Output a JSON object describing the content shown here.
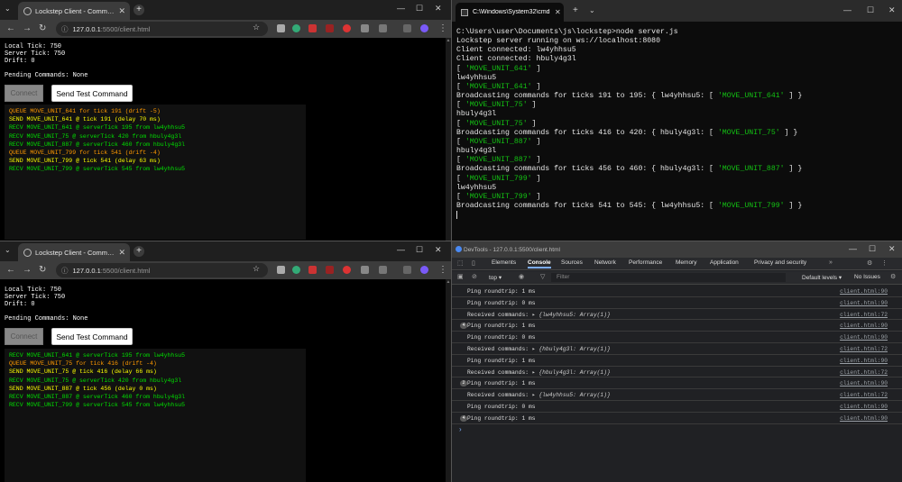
{
  "browser": {
    "tab_title": "Lockstep Client - Command Re",
    "url_host": "127.0.0.1",
    "url_path": ":5500/client.html"
  },
  "clients": [
    {
      "local_tick": "Local Tick: 750",
      "server_tick": "Server Tick: 750",
      "drift": "Drift: 0",
      "pending": "Pending Commands: None",
      "connect_label": "Connect",
      "send_label": "Send Test Command",
      "log": [
        {
          "kind": "queue",
          "text": "QUEUE MOVE_UNIT_641 for tick 191 (drift -5)"
        },
        {
          "kind": "send",
          "text": "SEND MOVE_UNIT_641 @ tick 191 (delay 70 ms)"
        },
        {
          "kind": "recv",
          "text": "RECV MOVE_UNIT_641 @ serverTick 195 from lw4yhhsu5"
        },
        {
          "kind": "recv",
          "text": "RECV MOVE_UNIT_75 @ serverTick 420 from hbuly4g3l"
        },
        {
          "kind": "recv",
          "text": "RECV MOVE_UNIT_887 @ serverTick 460 from hbuly4g3l"
        },
        {
          "kind": "queue",
          "text": "QUEUE MOVE_UNIT_799 for tick 541 (drift -4)"
        },
        {
          "kind": "send",
          "text": "SEND MOVE_UNIT_799 @ tick 541 (delay 63 ms)"
        },
        {
          "kind": "recv",
          "text": "RECV MOVE_UNIT_799 @ serverTick 545 from lw4yhhsu5"
        }
      ]
    },
    {
      "local_tick": "Local Tick: 750",
      "server_tick": "Server Tick: 750",
      "drift": "Drift: 0",
      "pending": "Pending Commands: None",
      "connect_label": "Connect",
      "send_label": "Send Test Command",
      "log": [
        {
          "kind": "recv",
          "text": "RECV MOVE_UNIT_641 @ serverTick 195 from lw4yhhsu5"
        },
        {
          "kind": "queue",
          "text": "QUEUE MOVE_UNIT_75 for tick 416 (drift -4)"
        },
        {
          "kind": "send",
          "text": "SEND MOVE_UNIT_75 @ tick 416 (delay 66 ms)"
        },
        {
          "kind": "recv",
          "text": "RECV MOVE_UNIT_75 @ serverTick 420 from hbuly4g3l"
        },
        {
          "kind": "send",
          "text": "SEND MOVE_UNIT_887 @ tick 456 (delay 0 ms)"
        },
        {
          "kind": "recv",
          "text": "RECV MOVE_UNIT_887 @ serverTick 460 from hbuly4g3l"
        },
        {
          "kind": "recv",
          "text": "RECV MOVE_UNIT_799 @ serverTick 545 from lw4yhhsu5"
        }
      ]
    }
  ],
  "cmd": {
    "tab_title": "C:\\Windows\\System32\\cmd.e",
    "lines": [
      [
        {
          "t": "C:\\Users\\user\\Documents\\js\\lockstep>node server.js"
        }
      ],
      [
        {
          "t": "Lockstep server running on ws://localhost:8080"
        }
      ],
      [
        {
          "t": "Client connected: lw4yhhsu5"
        }
      ],
      [
        {
          "t": "Client connected: hbuly4g3l"
        }
      ],
      [
        {
          "t": "[ "
        },
        {
          "t": "'MOVE_UNIT_641'",
          "g": true
        },
        {
          "t": " ]"
        }
      ],
      [
        {
          "t": "lw4yhhsu5"
        }
      ],
      [
        {
          "t": "[ "
        },
        {
          "t": "'MOVE_UNIT_641'",
          "g": true
        },
        {
          "t": " ]"
        }
      ],
      [
        {
          "t": "Broadcasting commands for ticks 191 to 195: { lw4yhhsu5: [ "
        },
        {
          "t": "'MOVE_UNIT_641'",
          "g": true
        },
        {
          "t": " ] }"
        }
      ],
      [
        {
          "t": "[ "
        },
        {
          "t": "'MOVE_UNIT_75'",
          "g": true
        },
        {
          "t": " ]"
        }
      ],
      [
        {
          "t": "hbuly4g3l"
        }
      ],
      [
        {
          "t": "[ "
        },
        {
          "t": "'MOVE_UNIT_75'",
          "g": true
        },
        {
          "t": " ]"
        }
      ],
      [
        {
          "t": "Broadcasting commands for ticks 416 to 420: { hbuly4g3l: [ "
        },
        {
          "t": "'MOVE_UNIT_75'",
          "g": true
        },
        {
          "t": " ] }"
        }
      ],
      [
        {
          "t": "[ "
        },
        {
          "t": "'MOVE_UNIT_887'",
          "g": true
        },
        {
          "t": " ]"
        }
      ],
      [
        {
          "t": "hbuly4g3l"
        }
      ],
      [
        {
          "t": "[ "
        },
        {
          "t": "'MOVE_UNIT_887'",
          "g": true
        },
        {
          "t": " ]"
        }
      ],
      [
        {
          "t": "Broadcasting commands for ticks 456 to 460: { hbuly4g3l: [ "
        },
        {
          "t": "'MOVE_UNIT_887'",
          "g": true
        },
        {
          "t": " ] }"
        }
      ],
      [
        {
          "t": "[ "
        },
        {
          "t": "'MOVE_UNIT_799'",
          "g": true
        },
        {
          "t": " ]"
        }
      ],
      [
        {
          "t": "lw4yhhsu5"
        }
      ],
      [
        {
          "t": "[ "
        },
        {
          "t": "'MOVE_UNIT_799'",
          "g": true
        },
        {
          "t": " ]"
        }
      ],
      [
        {
          "t": "Broadcasting commands for ticks 541 to 545: { lw4yhhsu5: [ "
        },
        {
          "t": "'MOVE_UNIT_799'",
          "g": true
        },
        {
          "t": " ] }"
        }
      ]
    ]
  },
  "devtools": {
    "title": "DevTools - 127.0.0.1:5500/client.html",
    "tabs": [
      "Elements",
      "Console",
      "Sources",
      "Network",
      "Performance",
      "Memory",
      "Application",
      "Privacy and security"
    ],
    "active_tab": "Console",
    "context": "top",
    "filter_placeholder": "Filter",
    "levels": "Default levels",
    "issues": "No Issues",
    "rows": [
      {
        "count": "",
        "msg": "Ping roundtrip: 1 ms",
        "obj": "",
        "src": "client.html:90"
      },
      {
        "count": "",
        "msg": "Ping roundtrip: 0 ms",
        "obj": "",
        "src": "client.html:90"
      },
      {
        "count": "",
        "msg": "Received commands: ",
        "obj": "{lw4yhhsu5: Array(1)}",
        "src": "client.html:72"
      },
      {
        "count": "4",
        "msg": "Ping roundtrip: 1 ms",
        "obj": "",
        "src": "client.html:90"
      },
      {
        "count": "",
        "msg": "Ping roundtrip: 0 ms",
        "obj": "",
        "src": "client.html:90"
      },
      {
        "count": "",
        "msg": "Received commands: ",
        "obj": "{hbuly4g3l: Array(1)}",
        "src": "client.html:72"
      },
      {
        "count": "",
        "msg": "Ping roundtrip: 1 ms",
        "obj": "",
        "src": "client.html:90"
      },
      {
        "count": "",
        "msg": "Received commands: ",
        "obj": "{hbuly4g3l: Array(1)}",
        "src": "client.html:72"
      },
      {
        "count": "2",
        "msg": "Ping roundtrip: 1 ms",
        "obj": "",
        "src": "client.html:90"
      },
      {
        "count": "",
        "msg": "Received commands: ",
        "obj": "{lw4yhhsu5: Array(1)}",
        "src": "client.html:72"
      },
      {
        "count": "",
        "msg": "Ping roundtrip: 0 ms",
        "obj": "",
        "src": "client.html:90"
      },
      {
        "count": "4",
        "msg": "Ping roundtrip: 1 ms",
        "obj": "",
        "src": "client.html:90"
      }
    ]
  },
  "colors": {
    "queue": "#ff9900",
    "send": "#ffff00",
    "recv": "#00e000",
    "cmd_green": "#13c213"
  }
}
